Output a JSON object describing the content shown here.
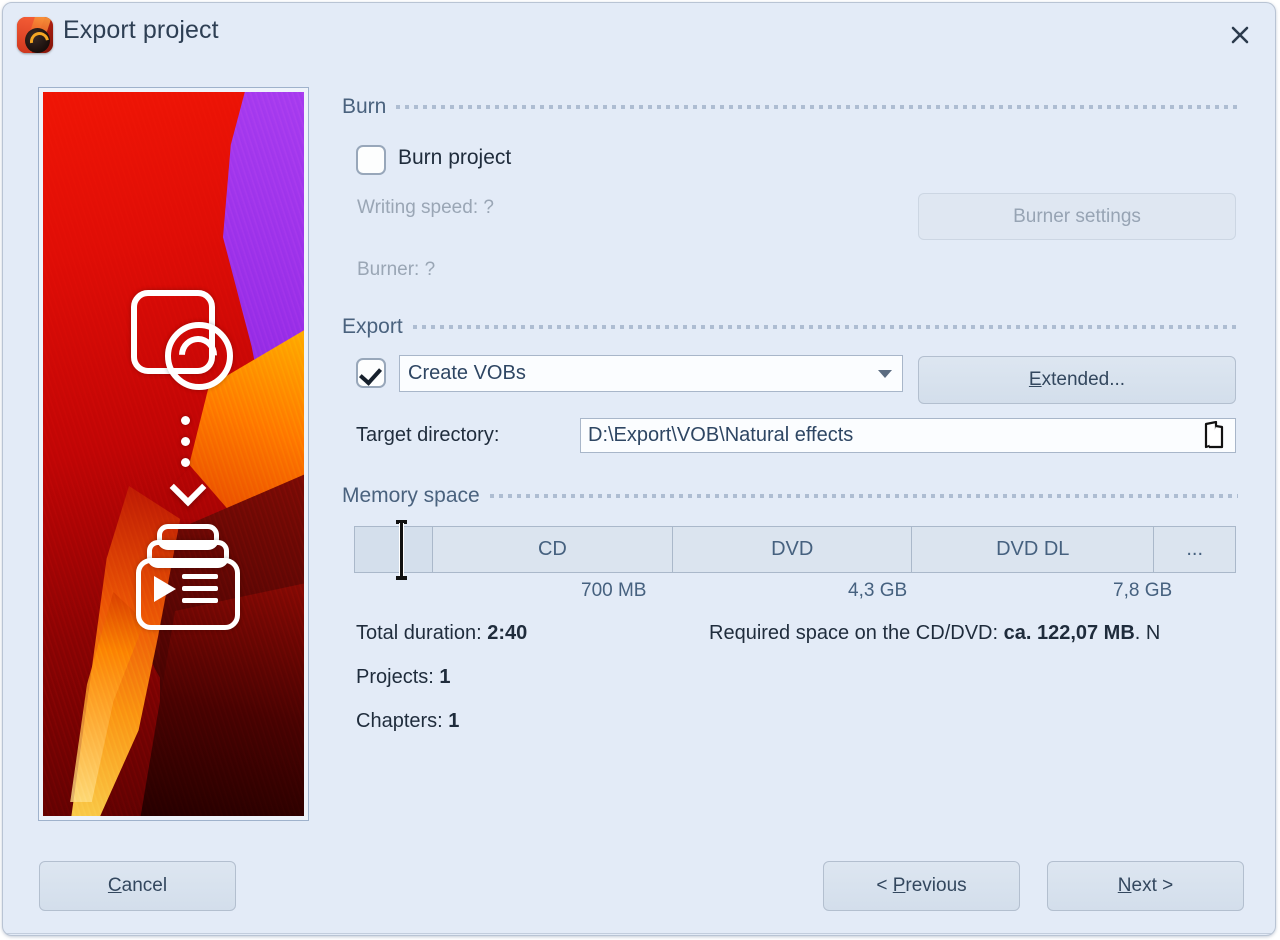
{
  "window": {
    "title": "Export project",
    "app_icon": "app-logo-icon",
    "close_label": "✕",
    "background_color": "#e3ebf7"
  },
  "preview": {
    "overlay_icons": [
      "menu-template-icon",
      "down-arrow-icon",
      "disc-stack-play-icon"
    ]
  },
  "burn_section": {
    "title": "Burn",
    "burn_project": {
      "label": "Burn project",
      "checked": false
    },
    "writing_speed": "Writing speed: ?",
    "burner": "Burner: ?",
    "burner_settings_button": "Burner settings"
  },
  "export_section": {
    "title": "Export",
    "export_enabled": true,
    "format_select": {
      "value": "Create VOBs",
      "caret": "chevron-down-icon"
    },
    "extended_button": {
      "accel": "E",
      "rest": "xtended..."
    },
    "target_directory": {
      "label": "Target directory:",
      "value": "D:\\Export\\VOB\\Natural effects",
      "browse_icon": "open-folder-icon"
    }
  },
  "memory_section": {
    "title": "Memory space",
    "segments": [
      {
        "label": "",
        "flex": 9.6
      },
      {
        "label": "CD",
        "flex": 30.0
      },
      {
        "label": "DVD",
        "flex": 29.8
      },
      {
        "label": "DVD DL",
        "flex": 30.2
      },
      {
        "label": "...",
        "flex": 10.1
      }
    ],
    "capacities": {
      "cd": "700 MB",
      "dvd": "4,3 GB",
      "dvd_dl": "7,8 GB"
    }
  },
  "stats": {
    "duration_label": "Total duration: ",
    "duration_value": "2:40",
    "projects_label": "Projects: ",
    "projects_value": "1",
    "chapters_label": "Chapters: ",
    "chapters_value": "1",
    "required_prefix": "Required space on the CD/DVD: ",
    "required_value": "ca. 122,07 MB",
    "required_suffix": ". N"
  },
  "footer": {
    "cancel": {
      "accel": "C",
      "rest": "ancel"
    },
    "previous": {
      "prefix": "< ",
      "accel": "P",
      "rest": "revious"
    },
    "next": {
      "accel": "N",
      "rest": "ext >"
    }
  }
}
